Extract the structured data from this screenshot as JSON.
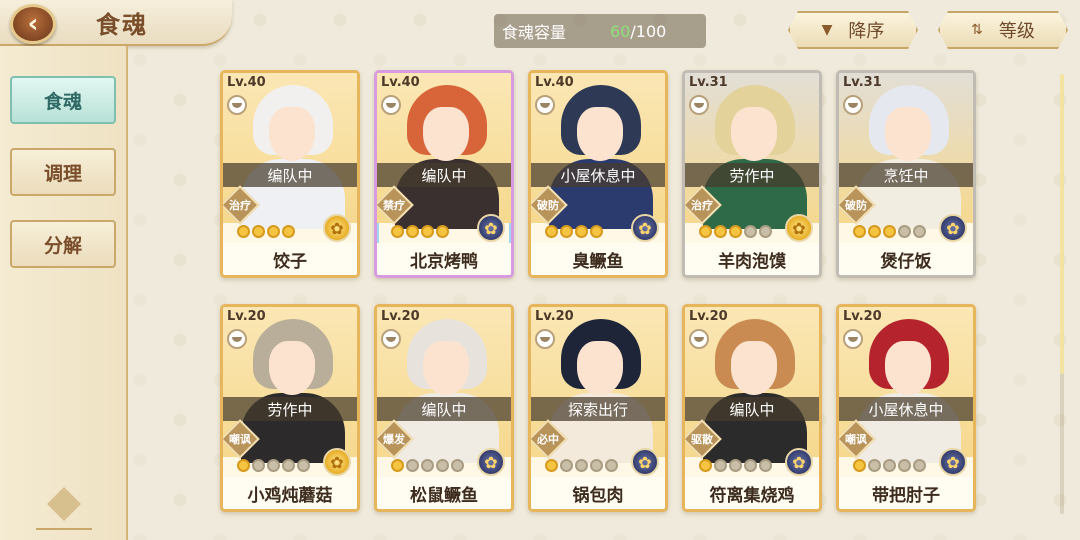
{
  "header": {
    "back_label": "‹",
    "title": "食魂",
    "capacity_label": "食魂容量",
    "capacity_current": "60",
    "capacity_max": "/100",
    "sort_order_label": "降序",
    "sort_order_icon": "triangle-down-icon",
    "sort_field_label": "等级",
    "sort_field_icon": "sort-arrows-icon"
  },
  "sidebar": {
    "tabs": [
      {
        "label": "食魂",
        "active": true
      },
      {
        "label": "调理",
        "active": false
      },
      {
        "label": "分解",
        "active": false
      }
    ]
  },
  "cards": [
    {
      "level": "Lv.40",
      "status": "编队中",
      "role": "治疗",
      "stars": 4,
      "max_stars": 4,
      "name": "饺子",
      "emblem": "gold",
      "frame": "gold",
      "hair": "#f2f0ee",
      "outfit": "#eef0f4"
    },
    {
      "level": "Lv.40",
      "status": "编队中",
      "role": "禁疗",
      "stars": 4,
      "max_stars": 4,
      "name": "北京烤鸭",
      "emblem": "blue",
      "frame": "rainbow",
      "hair": "#d8643a",
      "outfit": "#3b3030"
    },
    {
      "level": "Lv.40",
      "status": "小屋休息中",
      "role": "破防",
      "stars": 4,
      "max_stars": 4,
      "name": "臭鳜鱼",
      "emblem": "blue",
      "frame": "gold",
      "hair": "#2e3a55",
      "outfit": "#2b3b6e"
    },
    {
      "level": "Lv.31",
      "status": "劳作中",
      "role": "治疗",
      "stars": 3,
      "max_stars": 5,
      "name": "羊肉泡馍",
      "emblem": "gold",
      "frame": "silver",
      "hair": "#e3d29a",
      "outfit": "#2f6a48"
    },
    {
      "level": "Lv.31",
      "status": "烹饪中",
      "role": "破防",
      "stars": 3,
      "max_stars": 5,
      "name": "煲仔饭",
      "emblem": "blue",
      "frame": "silver",
      "hair": "#e6e8ef",
      "outfit": "#f1ede0"
    },
    {
      "level": "Lv.20",
      "status": "劳作中",
      "role": "嘲讽",
      "stars": 1,
      "max_stars": 5,
      "name": "小鸡炖蘑菇",
      "emblem": "gold",
      "frame": "gold",
      "hair": "#b9ae9a",
      "outfit": "#2c2a2a"
    },
    {
      "level": "Lv.20",
      "status": "编队中",
      "role": "爆发",
      "stars": 1,
      "max_stars": 5,
      "name": "松鼠鳜鱼",
      "emblem": "blue",
      "frame": "gold",
      "hair": "#e7e3dc",
      "outfit": "#f0ece3"
    },
    {
      "level": "Lv.20",
      "status": "探索出行",
      "role": "必中",
      "stars": 1,
      "max_stars": 5,
      "name": "锅包肉",
      "emblem": "blue",
      "frame": "gold",
      "hair": "#1f2538",
      "outfit": "#f3eadb"
    },
    {
      "level": "Lv.20",
      "status": "编队中",
      "role": "驱散",
      "stars": 1,
      "max_stars": 5,
      "name": "符离集烧鸡",
      "emblem": "blue",
      "frame": "gold",
      "hair": "#c98b52",
      "outfit": "#2b2b2b"
    },
    {
      "level": "Lv.20",
      "status": "小屋休息中",
      "role": "嘲讽",
      "stars": 1,
      "max_stars": 5,
      "name": "带把肘子",
      "emblem": "blue",
      "frame": "gold",
      "hair": "#b5232d",
      "outfit": "#f0ebe3"
    }
  ],
  "colors": {
    "accent_gold": "#e7b65c",
    "active_tab": "#b7e1d6",
    "capacity_green": "#8fe07a"
  }
}
